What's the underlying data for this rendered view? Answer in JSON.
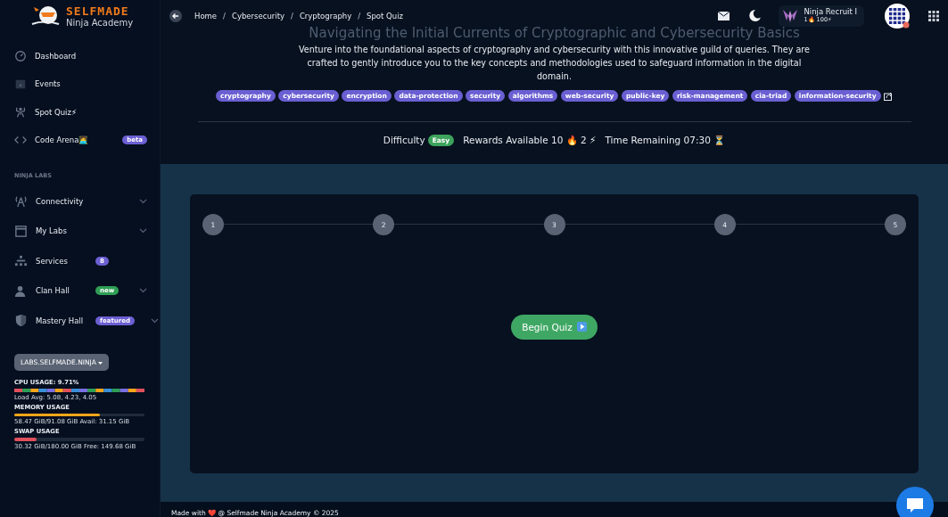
{
  "brand": {
    "name": "SELFMADE",
    "subtitle": "Ninja Academy"
  },
  "nav": [
    {
      "label": "Dashboard",
      "selected": false
    },
    {
      "label": "Events",
      "selected": false
    },
    {
      "label": "Spot Quiz",
      "emoji": "⚡",
      "selected": false
    },
    {
      "label": "Code Arena",
      "emoji": "🧑‍💻",
      "badge": {
        "text": "beta",
        "color": "#6c5fd3"
      },
      "selected": false
    }
  ],
  "section_label": "NINJA LABS",
  "labs": [
    {
      "label": "Connectivity",
      "expandable": true
    },
    {
      "label": "My Labs",
      "expandable": true
    },
    {
      "label": "Services",
      "expandable": false,
      "badge": {
        "text": "8",
        "color": "#6c5fd3"
      }
    },
    {
      "label": "Clan Hall",
      "expandable": true,
      "badge": {
        "text": "new",
        "color": "#2f9e55"
      }
    },
    {
      "label": "Mastery Hall",
      "expandable": true,
      "badge": {
        "text": "featured",
        "color": "#6c5fd3"
      }
    }
  ],
  "host_selector": "LABS.SELFMADE.NINJA",
  "usage": [
    {
      "kind": "multi",
      "label": "CPU USAGE: 9.71%",
      "detail": "Load Avg: 5.08, 4.23, 4.05"
    },
    {
      "kind": "level",
      "label": "MEMORY USAGE",
      "level": 0.66,
      "color": "#f3a51a",
      "detail": "58.47 GiB/91.08 GiB Avail: 31.15 GiB"
    },
    {
      "kind": "level",
      "label": "SWAP USAGE",
      "level": 0.17,
      "color": "#e0505c",
      "detail": "30.32 GiB/180.00 GiB Free: 149.68 GiB"
    }
  ],
  "breadcrumb": {
    "separator": "/",
    "items": [
      "Home",
      "Cybersecurity",
      "Cryptography",
      "Spot Quiz"
    ]
  },
  "user": {
    "name": "Ninja Recruit I",
    "stats": "1🔥 100⚡"
  },
  "quiz": {
    "title": "Navigating the Initial Currents of Cryptographic and Cybersecurity Basics",
    "description": "Venture into the foundational aspects of cryptography and cybersecurity with this innovative guild of queries. They are crafted to gently introduce you to the key concepts and methodologies used to safeguard information in the digital domain.",
    "tags": [
      "cryptography",
      "cybersecurity",
      "encryption",
      "data-protection",
      "security",
      "algorithms",
      "web-security",
      "public-key",
      "risk-management",
      "cia-triad",
      "information-security"
    ],
    "difficulty_label": "Difficulty",
    "difficulty": "Easy",
    "rewards": "Rewards Available 10 🔥 2 ⚡",
    "time": "Time Remaining 07:30 ⏳",
    "steps": [
      "1",
      "2",
      "3",
      "4",
      "5"
    ],
    "button": "Begin Quiz"
  },
  "footer": "Made with ❤️ @ Selfmade Ninja Academy © 2025"
}
